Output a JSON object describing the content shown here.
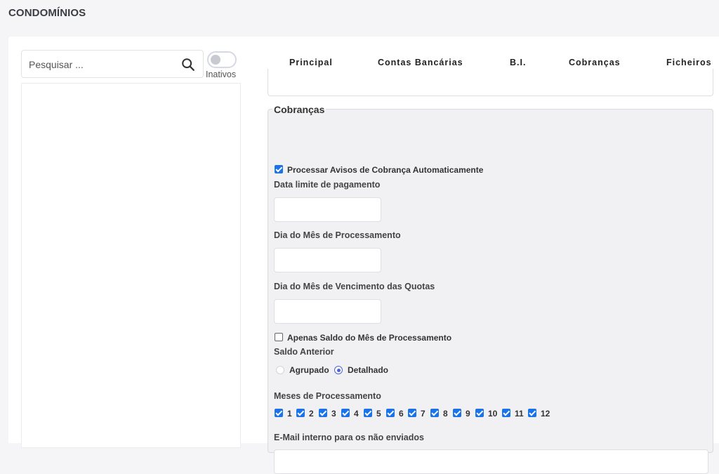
{
  "page": {
    "title": "CONDOMÍNIOS"
  },
  "search": {
    "placeholder": "Pesquisar ...",
    "value": ""
  },
  "toggle": {
    "label": "Inativos",
    "on": false
  },
  "tabs": [
    {
      "label": "Principal",
      "active": false
    },
    {
      "label": "Contas Bancárias",
      "active": false
    },
    {
      "label": "B.I.",
      "active": false
    },
    {
      "label": "Cobranças",
      "active": true
    },
    {
      "label": "Ficheiros",
      "active": false
    }
  ],
  "cobrancas": {
    "legend": "Cobranças",
    "auto_process": {
      "label": "Processar Avisos de Cobrança Automaticamente",
      "checked": true
    },
    "data_limite": {
      "label": "Data limite de pagamento",
      "value": ""
    },
    "dia_processamento": {
      "label": "Dia do Mês de Processamento",
      "value": ""
    },
    "dia_vencimento": {
      "label": "Dia do Mês de Vencimento das Quotas",
      "value": ""
    },
    "apenas_saldo": {
      "label": "Apenas Saldo do Mês de Processamento",
      "checked": false
    },
    "saldo_anterior": {
      "label": "Saldo Anterior",
      "options": [
        {
          "label": "Agrupado",
          "selected": false
        },
        {
          "label": "Detalhado",
          "selected": true
        }
      ]
    },
    "meses": {
      "label": "Meses de Processamento",
      "items": [
        "1",
        "2",
        "3",
        "4",
        "5",
        "6",
        "7",
        "8",
        "9",
        "10",
        "11",
        "12"
      ]
    },
    "email": {
      "label": "E-Mail interno para os não enviados",
      "value": ""
    }
  },
  "colors": {
    "accent": "#5a6bd8",
    "checkbox": "#1a73e8",
    "radio": "#4d63dc"
  }
}
